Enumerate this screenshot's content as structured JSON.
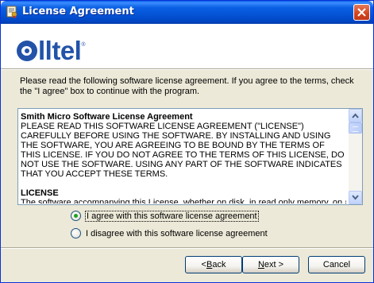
{
  "window": {
    "title": "License Agreement",
    "title_icon": "license-document-icon",
    "close_icon": "close-icon"
  },
  "logo": {
    "text": "lltel",
    "tm": "®",
    "brand_color": "#2253a8"
  },
  "intro_text": "Please read the following software license agreement.  If you agree to the terms, check the \"I agree\" box to continue with the program.",
  "license": {
    "title": "Smith Micro Software License Agreement",
    "body": "PLEASE READ THIS SOFTWARE LICENSE AGREEMENT (\"LICENSE\") CAREFULLY BEFORE USING THE SOFTWARE. BY INSTALLING AND USING THE SOFTWARE, YOU ARE AGREEING TO BE BOUND BY THE TERMS OF THIS LICENSE. IF YOU DO NOT AGREE TO THE TERMS OF THIS LICENSE, DO NOT USE THE SOFTWARE. USING ANY PART OF THE SOFTWARE INDICATES THAT YOU ACCEPT THESE TERMS.",
    "section_heading": "LICENSE"
  },
  "options": {
    "agree": {
      "label": "I agree with this software license agreement",
      "selected": true
    },
    "disagree": {
      "label": "I disagree with this software license agreement",
      "selected": false
    }
  },
  "buttons": {
    "back": {
      "prefix": "< ",
      "mnemonic": "B",
      "rest": "ack"
    },
    "next": {
      "mnemonic": "N",
      "rest": "ext >"
    },
    "cancel": "Cancel"
  }
}
